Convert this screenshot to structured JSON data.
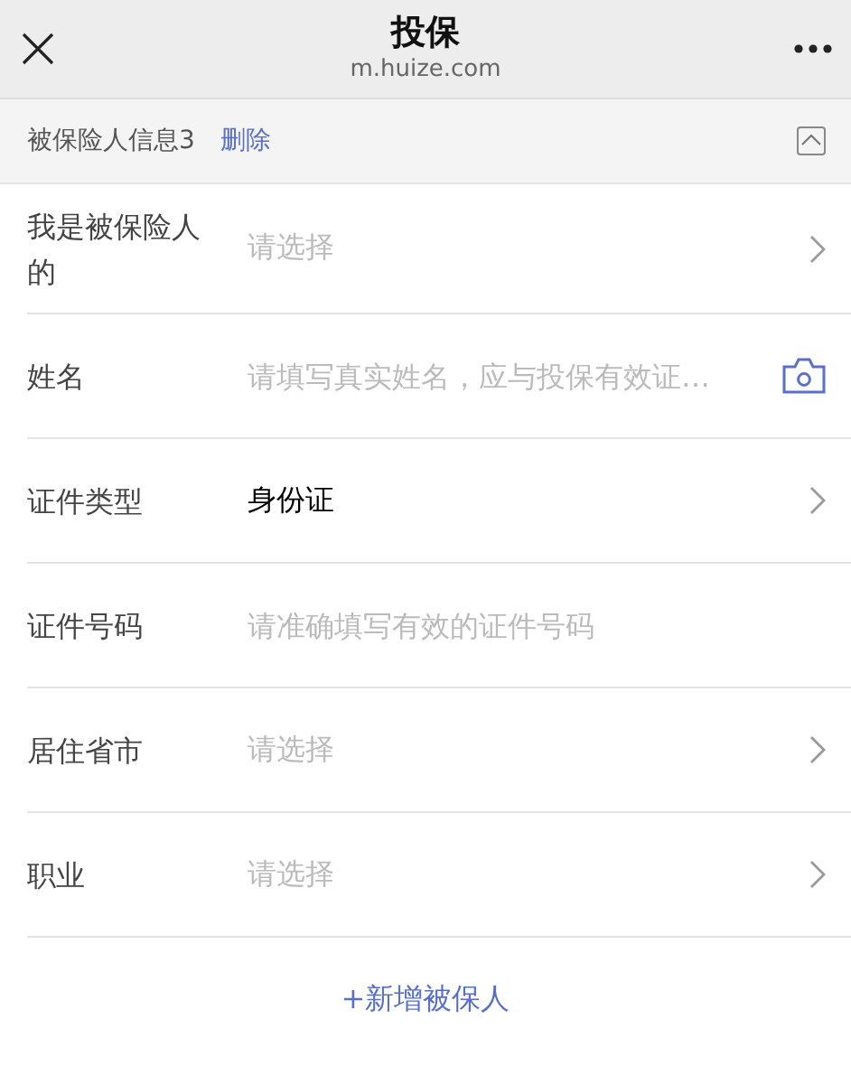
{
  "nav_bar": {
    "title": "投保",
    "subtitle": "m.huize.com"
  },
  "section": {
    "title": "被保险人信息3",
    "action": "删除",
    "expanded": true
  },
  "fields": [
    {
      "kind": "select",
      "label": "我是被保险人的",
      "placeholder": "请选择"
    },
    {
      "kind": "camera-input",
      "label": "姓名",
      "placeholder": "请填写真实姓名，应与投保有效证…"
    },
    {
      "kind": "select",
      "label": "证件类型",
      "value": "身份证"
    },
    {
      "kind": "input",
      "label": "证件号码",
      "placeholder": "请准确填写有效的证件号码"
    },
    {
      "kind": "select",
      "label": "居住省市",
      "placeholder": "请选择"
    },
    {
      "kind": "select",
      "label": "职业",
      "placeholder": "请选择"
    }
  ],
  "add_button": "+新增被保人"
}
